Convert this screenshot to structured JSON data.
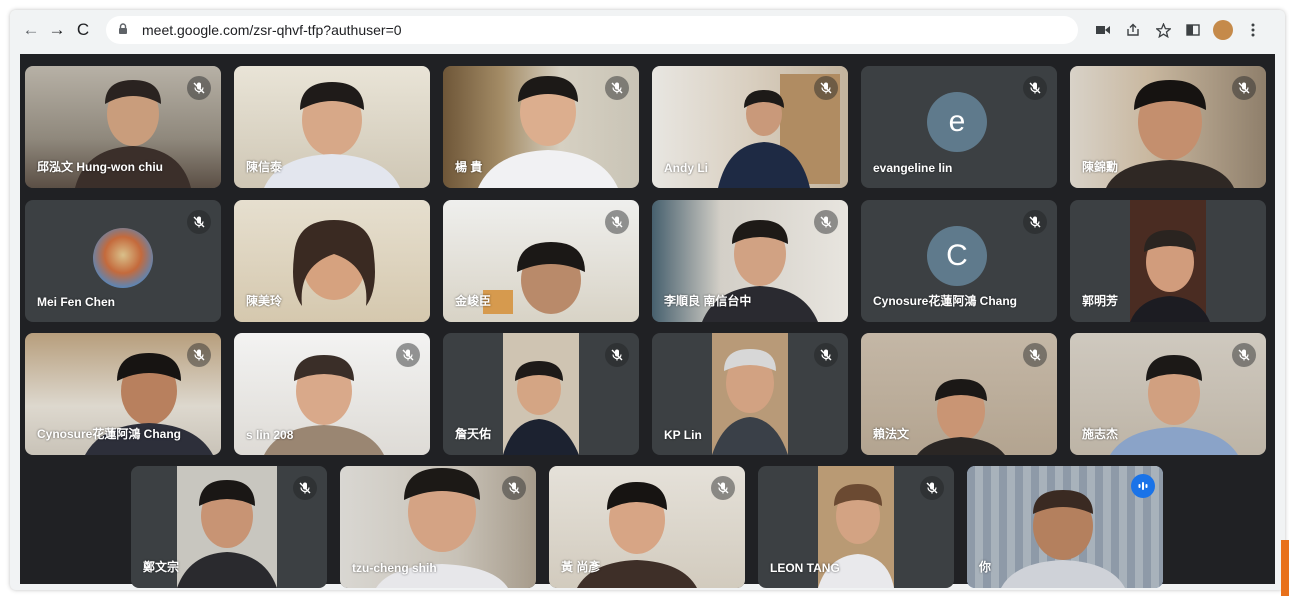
{
  "browser": {
    "url": "meet.google.com/zsr-qhvf-tfp?authuser=0",
    "back_icon": "←",
    "forward_icon": "→",
    "reload_icon": "C",
    "lock_icon": "🔒"
  },
  "participants_row1": [
    {
      "name": "邱泓文 Hung-won chiu"
    },
    {
      "name": "陳信泰"
    },
    {
      "name": "楊 貴"
    },
    {
      "name": "Andy Li"
    },
    {
      "name": "evangeline lin",
      "initial": "e"
    },
    {
      "name": "陳錦勳"
    }
  ],
  "participants_row2": [
    {
      "name": "Mei Fen Chen"
    },
    {
      "name": "陳美玲"
    },
    {
      "name": "金峻臣"
    },
    {
      "name": "李順良 南信台中"
    },
    {
      "name": "Cynosure花蓮阿鴻 Chang",
      "initial": "C"
    },
    {
      "name": "郭明芳"
    }
  ],
  "participants_row3": [
    {
      "name": "Cynosure花蓮阿鴻 Chang"
    },
    {
      "name": "s  lin  208"
    },
    {
      "name": "詹天佑"
    },
    {
      "name": "KP Lin"
    },
    {
      "name": "賴法文"
    },
    {
      "name": "施志杰"
    }
  ],
  "participants_row4": [
    {
      "name": "鄭文宗"
    },
    {
      "name": "tzu-cheng shih"
    },
    {
      "name": "黃 尚彥"
    },
    {
      "name": "LEON TANG"
    },
    {
      "name": "你"
    }
  ],
  "colors": {
    "accent": "#1a73e8",
    "tile": "#3c4043",
    "stage": "#202124"
  }
}
